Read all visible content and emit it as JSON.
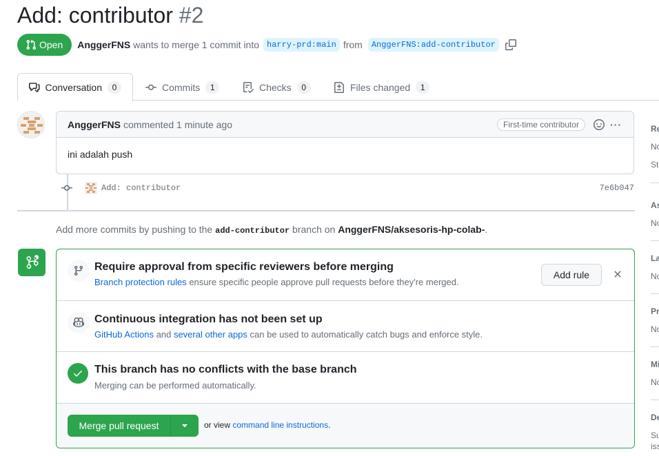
{
  "pr": {
    "title": "Add: contributor",
    "number": "#2",
    "state": "Open",
    "author": "AnggerFNS",
    "meta_middle": "wants to merge 1 commit into",
    "base_branch": "harry-prd:main",
    "from_word": "from",
    "head_branch": "AnggerFNS:add-contributor"
  },
  "tabs": [
    {
      "label": "Conversation",
      "count": "0"
    },
    {
      "label": "Commits",
      "count": "1"
    },
    {
      "label": "Checks",
      "count": "0"
    },
    {
      "label": "Files changed",
      "count": "1"
    }
  ],
  "comment": {
    "author": "AnggerFNS",
    "action": "commented",
    "time": "1 minute ago",
    "label": "First-time contributor",
    "body": "ini adalah push",
    "kebab": "···"
  },
  "commit": {
    "message": "Add: contributor",
    "sha": "7e6b047"
  },
  "push_hint": {
    "prefix": "Add more commits by pushing to the",
    "branch": "add-contributor",
    "middle": "branch on",
    "repo": "AnggerFNS/aksesoris-hp-colab-",
    "suffix": "."
  },
  "merge_box": {
    "protection": {
      "title": "Require approval from specific reviewers before merging",
      "link": "Branch protection rules",
      "text": "ensure specific people approve pull requests before they're merged.",
      "button": "Add rule"
    },
    "ci": {
      "title": "Continuous integration has not been set up",
      "link1": "GitHub Actions",
      "and": "and",
      "link2": "several other apps",
      "text": "can be used to automatically catch bugs and enforce style."
    },
    "conflicts": {
      "title": "This branch has no conflicts with the base branch",
      "text": "Merging can be performed automatically."
    },
    "merge_button": "Merge pull request",
    "or_view": "or view",
    "cli_link": "command line instructions",
    "period": "."
  },
  "sidebar": [
    {
      "head": "Re",
      "values": [
        "No",
        "St"
      ]
    },
    {
      "head": "As",
      "values": [
        "No"
      ]
    },
    {
      "head": "La",
      "values": [
        "No"
      ]
    },
    {
      "head": "Pr",
      "values": [
        "No"
      ]
    },
    {
      "head": "Mi",
      "values": [
        "No"
      ]
    },
    {
      "head": "De",
      "values": [
        "Su",
        "iss"
      ]
    }
  ],
  "colors": {
    "accent_green": "#2da44e",
    "link_blue": "#0969da",
    "muted": "#656d76"
  }
}
